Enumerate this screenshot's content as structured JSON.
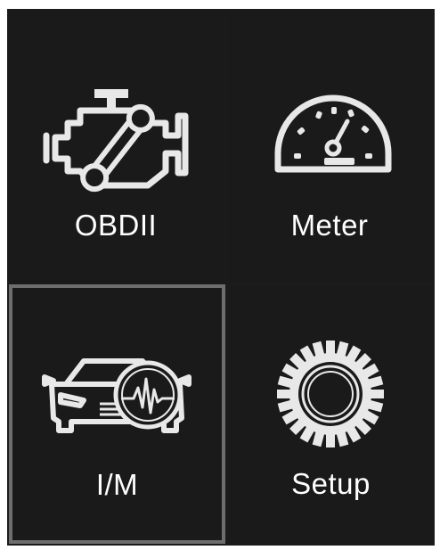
{
  "menu": {
    "items": [
      {
        "label": "OBDII",
        "icon": "engine-icon"
      },
      {
        "label": "Meter",
        "icon": "speedometer-icon"
      },
      {
        "label": "I/M",
        "icon": "car-diagnostic-icon"
      },
      {
        "label": "Setup",
        "icon": "gear-icon"
      }
    ],
    "selected": "I/M"
  },
  "colors": {
    "background": "#1a1a1a",
    "icon": "#e8e8e8",
    "text": "#ffffff",
    "selection_border": "#6e6e6e"
  }
}
